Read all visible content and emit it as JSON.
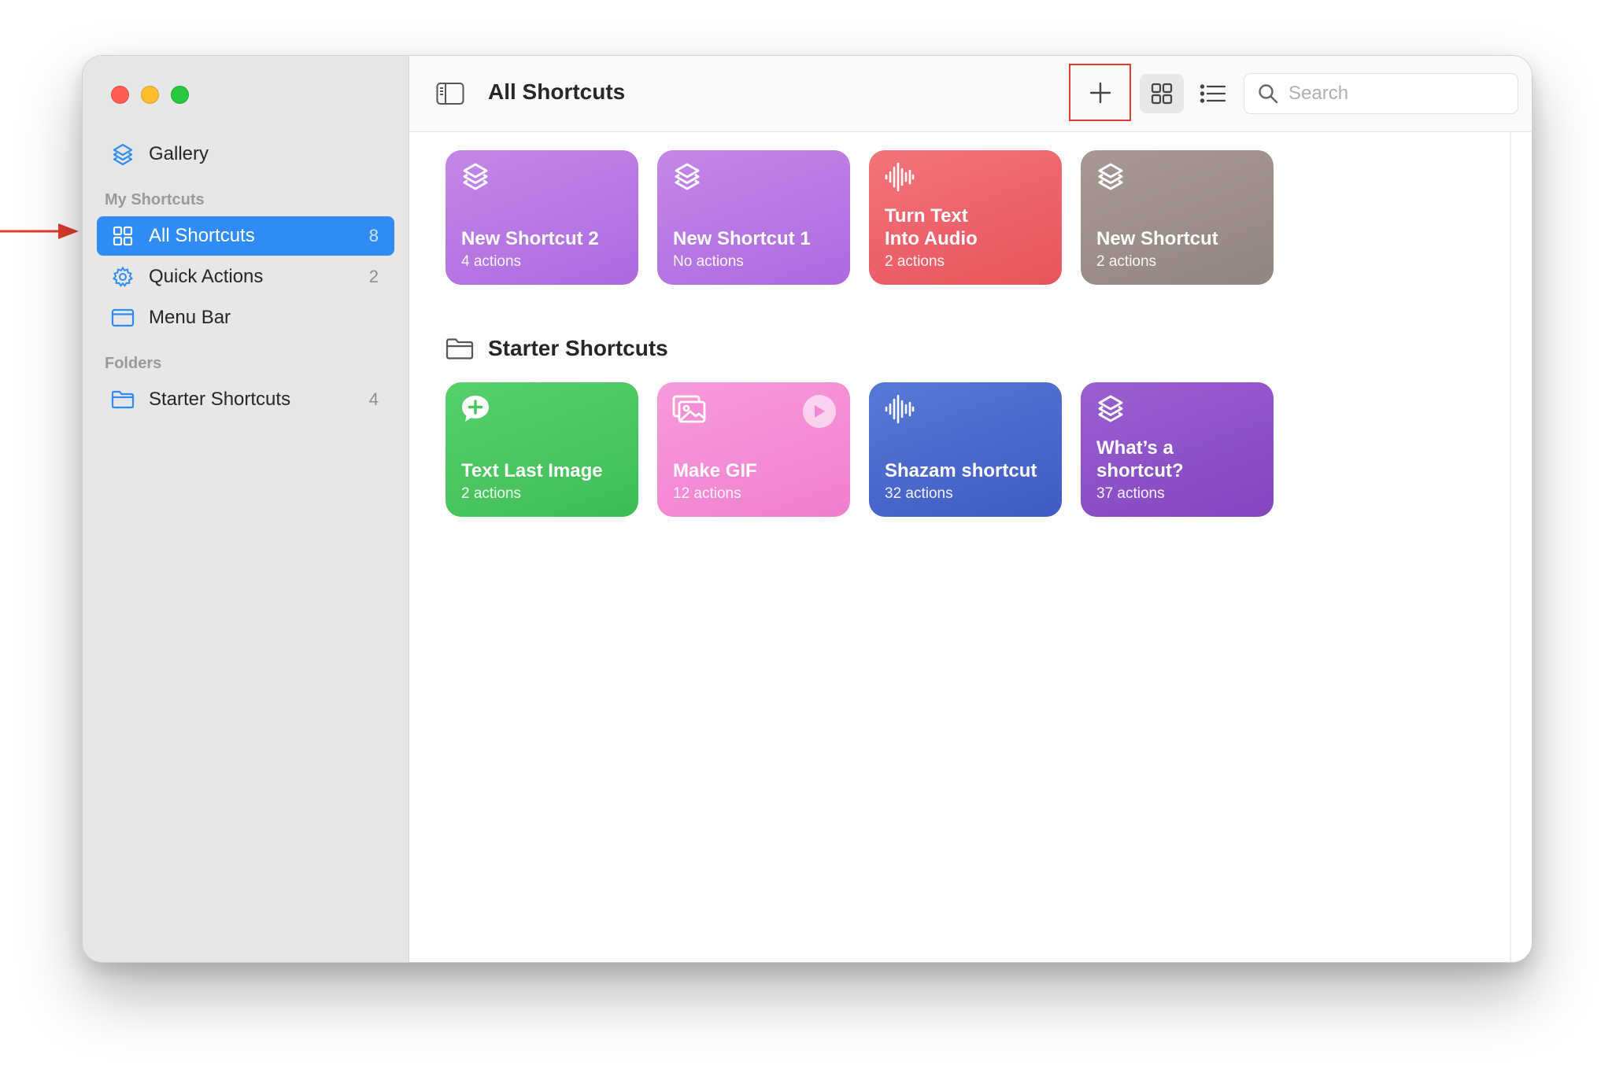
{
  "window": {
    "title": "All Shortcuts"
  },
  "sidebar": {
    "gallery_label": "Gallery",
    "section_my": "My Shortcuts",
    "items": [
      {
        "label": "All Shortcuts",
        "count": "8",
        "icon": "grid-icon",
        "active": true
      },
      {
        "label": "Quick Actions",
        "count": "2",
        "icon": "gear-icon",
        "active": false
      },
      {
        "label": "Menu Bar",
        "count": "",
        "icon": "menubar-icon",
        "active": false
      }
    ],
    "section_folders": "Folders",
    "folders": [
      {
        "label": "Starter Shortcuts",
        "count": "4",
        "icon": "folder-icon"
      }
    ]
  },
  "toolbar": {
    "title": "All Shortcuts",
    "search_placeholder": "Search",
    "add_icon": "plus-icon",
    "grid_icon": "grid-view-icon",
    "list_icon": "list-view-icon"
  },
  "shortcuts": [
    {
      "name": "New Shortcut 2",
      "actions": "4 actions",
      "icon": "layers-icon",
      "color": "#b57ae3"
    },
    {
      "name": "New Shortcut 1",
      "actions": "No actions",
      "icon": "layers-icon",
      "color": "#b57ae3"
    },
    {
      "name": "Turn Text Into Audio",
      "name_line1": "Turn Text",
      "name_line2": "Into Audio",
      "actions": "2 actions",
      "icon": "waveform-icon",
      "color": "#ee5d62"
    },
    {
      "name": "New Shortcut",
      "actions": "2 actions",
      "icon": "layers-icon",
      "color": "#9e8f88"
    }
  ],
  "starter_section": {
    "title": "Starter Shortcuts"
  },
  "starter_shortcuts": [
    {
      "name": "Text Last Image",
      "actions": "2 actions",
      "icon": "message-plus-icon",
      "color": "#48c75f"
    },
    {
      "name": "Make GIF",
      "actions": "12 actions",
      "icon": "photos-icon",
      "color": "#f48bd5"
    },
    {
      "name": "Shazam shortcut",
      "actions": "32 actions",
      "icon": "waveform-icon",
      "color": "#4464cb"
    },
    {
      "name": "What’s a shortcut?",
      "name_line1": "What’s a",
      "name_line2": "shortcut?",
      "actions": "37 actions",
      "icon": "layers-icon",
      "color": "#8e50c7"
    }
  ],
  "colors": {
    "accent": "#2f8cf4",
    "annotation_red": "#e23b2f"
  }
}
